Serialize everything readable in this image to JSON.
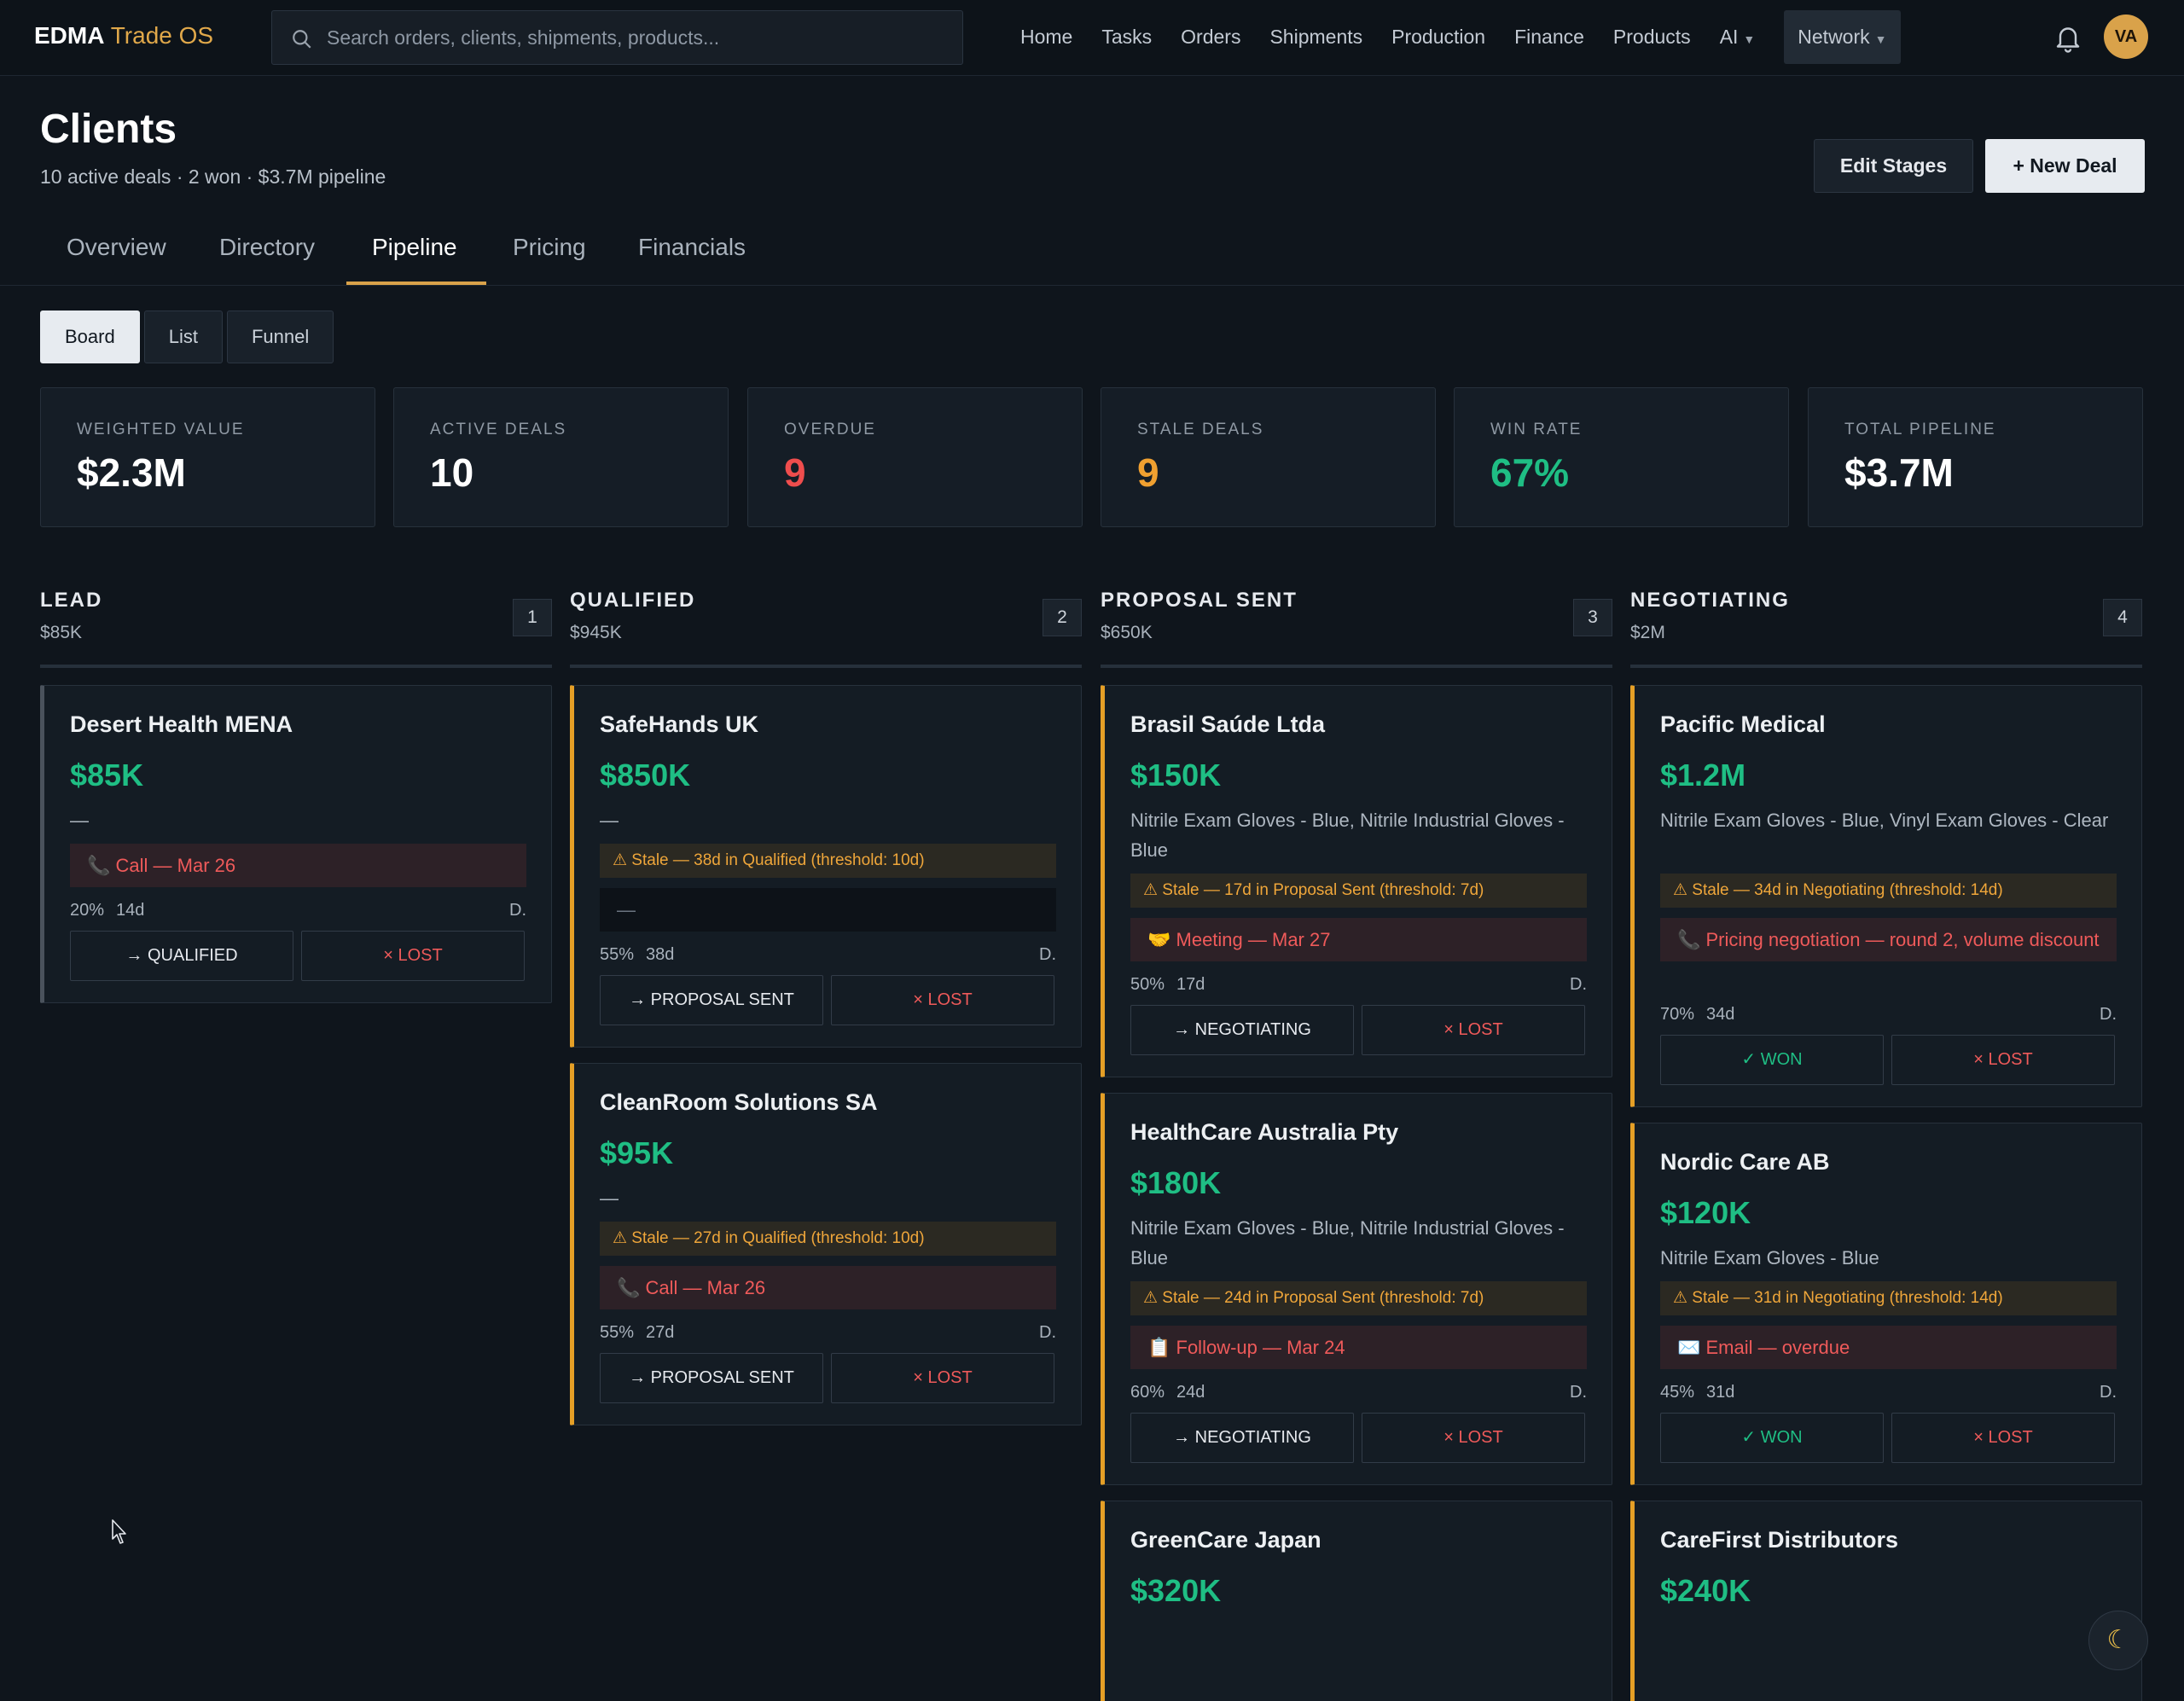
{
  "brand": {
    "part1": "EDMA",
    "part2": "Trade OS"
  },
  "search": {
    "placeholder": "Search orders, clients, shipments, products..."
  },
  "nav": {
    "items": [
      "Home",
      "Tasks",
      "Orders",
      "Shipments",
      "Production",
      "Finance",
      "Products",
      "AI",
      "Network"
    ]
  },
  "user": {
    "initials": "VA"
  },
  "page": {
    "title": "Clients",
    "subtitle": "10 active deals · 2 won · $3.7M pipeline"
  },
  "actions": {
    "edit": "Edit Stages",
    "new": "+ New Deal"
  },
  "tabs": [
    "Overview",
    "Directory",
    "Pipeline",
    "Pricing",
    "Financials"
  ],
  "active_tab": "Pipeline",
  "views": [
    "Board",
    "List",
    "Funnel"
  ],
  "active_view": "Board",
  "stats": [
    {
      "label": "WEIGHTED VALUE",
      "value": "$2.3M",
      "color": "#ffffff"
    },
    {
      "label": "ACTIVE DEALS",
      "value": "10",
      "color": "#ffffff"
    },
    {
      "label": "OVERDUE",
      "value": "9",
      "color": "#ef4d4d"
    },
    {
      "label": "STALE DEALS",
      "value": "9",
      "color": "#f0a030"
    },
    {
      "label": "WIN RATE",
      "value": "67%",
      "color": "#1fbe84"
    },
    {
      "label": "TOTAL PIPELINE",
      "value": "$3.7M",
      "color": "#ffffff"
    }
  ],
  "columns": [
    {
      "name": "LEAD",
      "total": "$85K",
      "count": "1",
      "cards": [
        {
          "name": "Desert Health MENA",
          "value": "$85K",
          "products": "—",
          "stale": "",
          "task": "📞 Call — Mar 26",
          "prob": "20%",
          "days": "14d",
          "owner": "D.",
          "move": "→ QUALIFIED",
          "lost": "× LOST"
        }
      ]
    },
    {
      "name": "QUALIFIED",
      "total": "$945K",
      "count": "2",
      "cards": [
        {
          "name": "SafeHands UK",
          "value": "$850K",
          "products": "—",
          "stale": "⚠ Stale — 38d in Qualified (threshold: 10d)",
          "task": "—",
          "prob": "55%",
          "days": "38d",
          "owner": "D.",
          "move": "→ PROPOSAL SENT",
          "lost": "× LOST"
        },
        {
          "name": "CleanRoom Solutions SA",
          "value": "$95K",
          "products": "—",
          "stale": "⚠ Stale — 27d in Qualified (threshold: 10d)",
          "task": "📞 Call — Mar 26",
          "prob": "55%",
          "days": "27d",
          "owner": "D.",
          "move": "→ PROPOSAL SENT",
          "lost": "× LOST"
        }
      ]
    },
    {
      "name": "PROPOSAL SENT",
      "total": "$650K",
      "count": "3",
      "cards": [
        {
          "name": "Brasil Saúde Ltda",
          "value": "$150K",
          "products": "Nitrile Exam Gloves - Blue, Nitrile Industrial Gloves - Blue",
          "stale": "⚠ Stale — 17d in Proposal Sent (threshold: 7d)",
          "task": "🤝 Meeting — Mar 27",
          "prob": "50%",
          "days": "17d",
          "owner": "D.",
          "move": "→ NEGOTIATING",
          "lost": "× LOST"
        },
        {
          "name": "HealthCare Australia Pty",
          "value": "$180K",
          "products": "Nitrile Exam Gloves - Blue, Nitrile Industrial Gloves - Blue",
          "stale": "⚠ Stale — 24d in Proposal Sent (threshold: 7d)",
          "task": "📋 Follow-up — Mar 24",
          "prob": "60%",
          "days": "24d",
          "owner": "D.",
          "move": "→ NEGOTIATING",
          "lost": "× LOST"
        },
        {
          "name": "GreenCare Japan",
          "value": "$320K"
        }
      ]
    },
    {
      "name": "NEGOTIATING",
      "total": "$2M",
      "count": "4",
      "cards": [
        {
          "name": "Pacific Medical",
          "value": "$1.2M",
          "products": "Nitrile Exam Gloves - Blue, Vinyl Exam Gloves - Clear",
          "stale": "⚠ Stale — 34d in Negotiating (threshold: 14d)",
          "task": "📞 Pricing negotiation — round 2, volume discount",
          "prob": "70%",
          "days": "34d",
          "owner": "D.",
          "move": "✓ WON",
          "lost": "× LOST"
        },
        {
          "name": "Nordic Care AB",
          "value": "$120K",
          "products": "Nitrile Exam Gloves - Blue",
          "stale": "⚠ Stale — 31d in Negotiating (threshold: 14d)",
          "task": "✉️ Email — overdue",
          "prob": "45%",
          "days": "31d",
          "owner": "D.",
          "move": "✓ WON",
          "lost": "× LOST"
        },
        {
          "name": "CareFirst Distributors",
          "value": "$240K"
        }
      ]
    }
  ]
}
